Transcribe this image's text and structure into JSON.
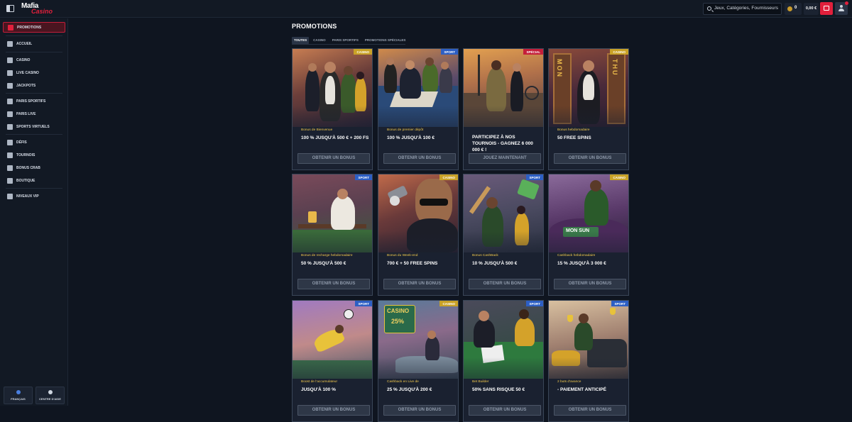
{
  "header": {
    "logo_line1": "Mafia",
    "logo_line2": "Casino",
    "search_placeholder": "Jeux, Catégories, Fournisseurs",
    "coins_value": "0",
    "balance": "0,00 €"
  },
  "sidebar": {
    "items": [
      {
        "label": "Promotions",
        "icon": "gift-icon",
        "active": true
      },
      {
        "label": "Accueil",
        "icon": "home-icon"
      },
      {
        "label": "Casino",
        "icon": "cards-icon"
      },
      {
        "label": "Live Casino",
        "icon": "live-icon"
      },
      {
        "label": "Jackpots",
        "icon": "clover-icon"
      },
      {
        "label": "Paris sportifs",
        "icon": "ball-icon"
      },
      {
        "label": "Paris Live",
        "icon": "live-bet-icon"
      },
      {
        "label": "Sports virtuels",
        "icon": "virtual-icon"
      },
      {
        "label": "Défis",
        "icon": "target-icon"
      },
      {
        "label": "Tournois",
        "icon": "trophy-icon"
      },
      {
        "label": "Bonus Crab",
        "icon": "claw-icon"
      },
      {
        "label": "Boutique",
        "icon": "shop-icon"
      },
      {
        "label": "Niveaux VIP",
        "icon": "crown-icon"
      }
    ],
    "language_label": "Français",
    "help_label": "Centre d'aide"
  },
  "main": {
    "title": "PROMOTIONS",
    "tabs": [
      "Toutes",
      "Casino",
      "Paris sportifs",
      "Promotions spéciales"
    ],
    "cards": [
      {
        "badge": "Casino",
        "subtitle": "Bonus de Bienvenue",
        "title": "100 % jusqu'à 500 € + 200 FS",
        "button": "Obtenir un bonus"
      },
      {
        "badge": "Sport",
        "subtitle": "Bonus de premier dépôt",
        "title": "100 % jusqu'à 100 €",
        "button": "Obtenir un bonus"
      },
      {
        "badge": "Spécial",
        "subtitle": "",
        "title": "Participez à nos tournois - Gagnez 6 000 000 € !",
        "button": "Jouez maintenant"
      },
      {
        "badge": "Casino",
        "subtitle": "Bonus hebdomadaire",
        "title": "50 free spins",
        "button": "Obtenir un bonus"
      },
      {
        "badge": "Sport",
        "subtitle": "Bonus de recharge hebdomadaire",
        "title": "50 % jusqu'à 500 €",
        "button": "Obtenir un bonus"
      },
      {
        "badge": "Casino",
        "subtitle": "Bonus du Week-end",
        "title": "700 € + 50 free spins",
        "button": "Obtenir un bonus"
      },
      {
        "badge": "Sport",
        "subtitle": "Bonus CashBack",
        "title": "10 % jusqu'à 500 €",
        "button": "Obtenir un bonus"
      },
      {
        "badge": "Casino",
        "subtitle": "Cashback hebdomadaire",
        "title": "15 % jusqu'à 3 000 €",
        "button": "Obtenir un bonus"
      },
      {
        "badge": "Sport",
        "subtitle": "Boost de l'accumulateur",
        "title": "Jusqu'à 100 %",
        "button": "Obtenir un bonus"
      },
      {
        "badge": "Casino",
        "subtitle": "Cashback en Live de",
        "title": "25 % jusqu'à 200 €",
        "button": "Obtenir un bonus"
      },
      {
        "badge": "Sport",
        "subtitle": "Bet Builder",
        "title": "50% sans risque 50 €",
        "button": "Obtenir un bonus"
      },
      {
        "badge": "Sport",
        "subtitle": "2 buts d'avance",
        "title": "- paiement anticipé",
        "button": "Obtenir un bonus"
      }
    ],
    "art_labels": {
      "card4_left": "MON",
      "card4_right": "THU",
      "card8_sign": "MON SUN",
      "card10_sign_top": "CASINO",
      "card10_sign_bottom": "25%"
    }
  },
  "colors": {
    "accent": "#e2203c",
    "badge_casino": "#c9a227",
    "badge_sport": "#2d5fc4",
    "badge_special": "#c41e3a"
  }
}
